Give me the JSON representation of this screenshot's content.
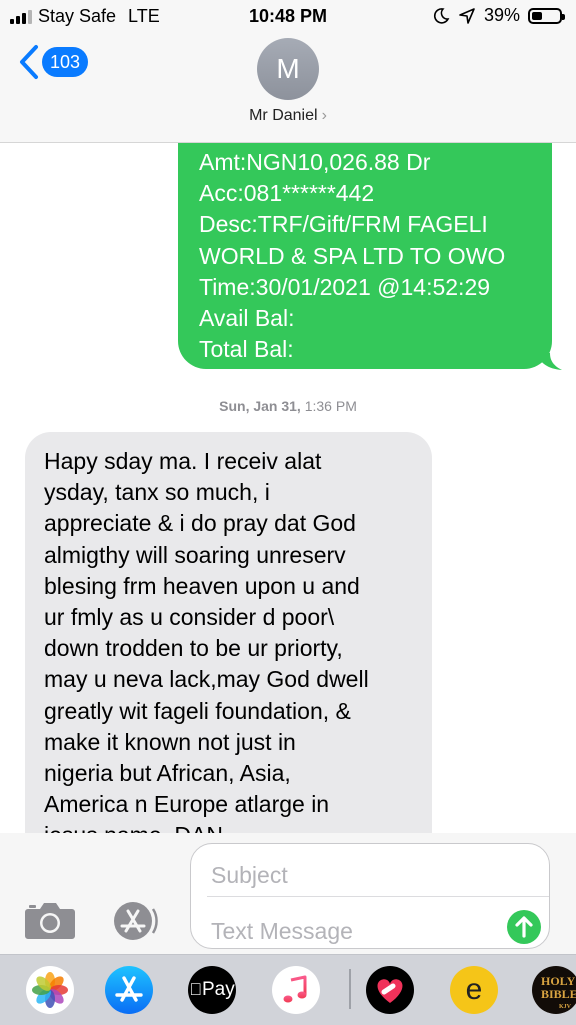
{
  "status_bar": {
    "carrier": "Stay Safe",
    "network": "LTE",
    "time": "10:48 PM",
    "battery_percent": "39%",
    "battery_level": 0.39
  },
  "header": {
    "back_count": "103",
    "avatar_initial": "M",
    "contact_name": "Mr Daniel"
  },
  "messages": {
    "sent": {
      "lines": [
        "Amt:NGN10,026.88 Dr",
        "Acc:081******442",
        "Desc:TRF/Gift/FRM FAGELI",
        "WORLD & SPA LTD TO OWO",
        "Time:30/01/2021 @14:52:29",
        "Avail Bal:",
        "Total Bal:"
      ]
    },
    "timestamp": {
      "day": "Sun, Jan 31,",
      "time": "1:36 PM"
    },
    "received": {
      "lines": [
        "Hapy sday ma. I receiv alat",
        "ysday, tanx so much, i",
        "appreciate & i do pray dat  God",
        "almigthy will soaring unreserv",
        "blesing frm heaven upon u and",
        "ur fmly as u consider d poor\\",
        "down trodden to be ur priorty,",
        "may u neva lack,may God dwell",
        "greatly wit fageli foundation, &",
        "make it known not just in",
        "nigeria but African, Asia,",
        "America n Europe atlarge in",
        "jesus name. DAN"
      ]
    }
  },
  "compose": {
    "subject_placeholder": "Subject",
    "message_placeholder": "Text Message"
  },
  "app_drawer": {
    "apps": [
      "photos-app-icon",
      "app-store-icon",
      "apple-pay-icon",
      "music-icon",
      "heart-sticker-app-icon",
      "e-app-icon",
      "holy-bible-icon"
    ],
    "pay_label": "Pay",
    "e_label": "e",
    "bible_label": "HOLY BIBLE",
    "bible_sub": "KJV"
  }
}
